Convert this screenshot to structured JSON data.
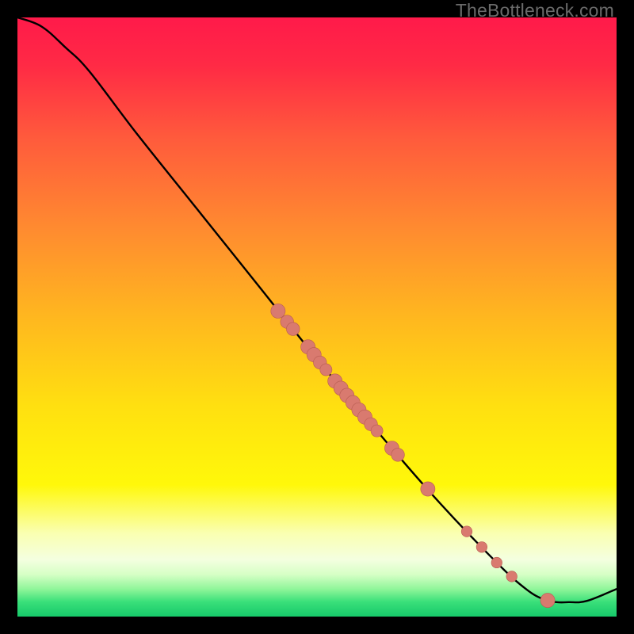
{
  "watermark": "TheBottleneck.com",
  "colors": {
    "curve_stroke": "#000000",
    "marker_fill": "#d97a6f",
    "marker_stroke": "#b85d52",
    "frame_bg_black": "#000000"
  },
  "chart_data": {
    "type": "line",
    "title": "",
    "xlabel": "",
    "ylabel": "",
    "xlim": [
      0,
      100
    ],
    "ylim": [
      0,
      100
    ],
    "curve_points": [
      {
        "x": 0,
        "y": 100
      },
      {
        "x": 4,
        "y": 98.5
      },
      {
        "x": 8,
        "y": 95
      },
      {
        "x": 12,
        "y": 91
      },
      {
        "x": 20,
        "y": 80.5
      },
      {
        "x": 30,
        "y": 68
      },
      {
        "x": 40,
        "y": 55.5
      },
      {
        "x": 50,
        "y": 43
      },
      {
        "x": 60,
        "y": 31
      },
      {
        "x": 70,
        "y": 19.5
      },
      {
        "x": 80,
        "y": 9
      },
      {
        "x": 85,
        "y": 4.5
      },
      {
        "x": 88,
        "y": 2.8
      },
      {
        "x": 90,
        "y": 2.4
      },
      {
        "x": 92,
        "y": 2.4
      },
      {
        "x": 95,
        "y": 2.6
      },
      {
        "x": 100,
        "y": 4.6
      }
    ],
    "markers": [
      {
        "x": 43.5,
        "y": 51.0,
        "r": 1.2
      },
      {
        "x": 45.0,
        "y": 49.2,
        "r": 1.1
      },
      {
        "x": 46.0,
        "y": 48.0,
        "r": 1.1
      },
      {
        "x": 48.5,
        "y": 45.0,
        "r": 1.2
      },
      {
        "x": 49.5,
        "y": 43.7,
        "r": 1.2
      },
      {
        "x": 50.5,
        "y": 42.4,
        "r": 1.1
      },
      {
        "x": 51.5,
        "y": 41.2,
        "r": 1.0
      },
      {
        "x": 53.0,
        "y": 39.3,
        "r": 1.2
      },
      {
        "x": 54.0,
        "y": 38.1,
        "r": 1.2
      },
      {
        "x": 55.0,
        "y": 36.9,
        "r": 1.2
      },
      {
        "x": 56.0,
        "y": 35.7,
        "r": 1.2
      },
      {
        "x": 57.0,
        "y": 34.5,
        "r": 1.2
      },
      {
        "x": 58.0,
        "y": 33.3,
        "r": 1.2
      },
      {
        "x": 59.0,
        "y": 32.1,
        "r": 1.1
      },
      {
        "x": 60.0,
        "y": 31.0,
        "r": 1.0
      },
      {
        "x": 62.5,
        "y": 28.1,
        "r": 1.2
      },
      {
        "x": 63.5,
        "y": 27.0,
        "r": 1.1
      },
      {
        "x": 68.5,
        "y": 21.3,
        "r": 1.2
      },
      {
        "x": 75.0,
        "y": 14.2,
        "r": 0.9
      },
      {
        "x": 77.5,
        "y": 11.6,
        "r": 0.9
      },
      {
        "x": 80.0,
        "y": 9.0,
        "r": 0.9
      },
      {
        "x": 82.5,
        "y": 6.7,
        "r": 0.9
      },
      {
        "x": 88.5,
        "y": 2.7,
        "r": 1.2
      }
    ],
    "gradient_stops": [
      {
        "offset": 0.0,
        "color": "#ff1a4a"
      },
      {
        "offset": 0.08,
        "color": "#ff2a45"
      },
      {
        "offset": 0.2,
        "color": "#ff5a3c"
      },
      {
        "offset": 0.35,
        "color": "#ff8a30"
      },
      {
        "offset": 0.5,
        "color": "#ffb71f"
      },
      {
        "offset": 0.65,
        "color": "#ffe010"
      },
      {
        "offset": 0.78,
        "color": "#fff80a"
      },
      {
        "offset": 0.86,
        "color": "#faffb0"
      },
      {
        "offset": 0.905,
        "color": "#f4ffe0"
      },
      {
        "offset": 0.93,
        "color": "#d6ffc5"
      },
      {
        "offset": 0.955,
        "color": "#8cf598"
      },
      {
        "offset": 0.975,
        "color": "#3be07a"
      },
      {
        "offset": 1.0,
        "color": "#16c96a"
      }
    ]
  }
}
